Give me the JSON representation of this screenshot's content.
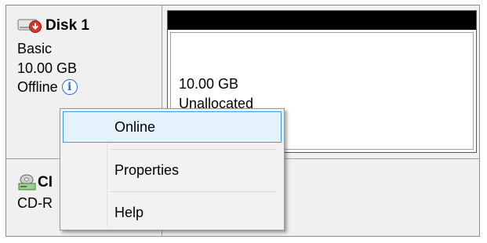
{
  "disk": {
    "title": "Disk 1",
    "type": "Basic",
    "size": "10.00 GB",
    "status": "Offline",
    "info_symbol": "i"
  },
  "volume": {
    "size": "10.00 GB",
    "label": "Unallocated"
  },
  "cd": {
    "title_partial": "CI",
    "type_partial": "CD-R"
  },
  "context_menu": {
    "items": [
      {
        "label": "Online"
      },
      {
        "label": "Properties"
      },
      {
        "label": "Help"
      }
    ]
  },
  "colors": {
    "highlight_border": "#3c9be6",
    "highlight_fill": "#e5f1fb",
    "info_blue": "#2a6edb",
    "offline_red": "#d9342b"
  },
  "icons": {
    "disk": "disk-offline-icon",
    "info": "info-icon",
    "cd": "cd-drive-icon"
  }
}
